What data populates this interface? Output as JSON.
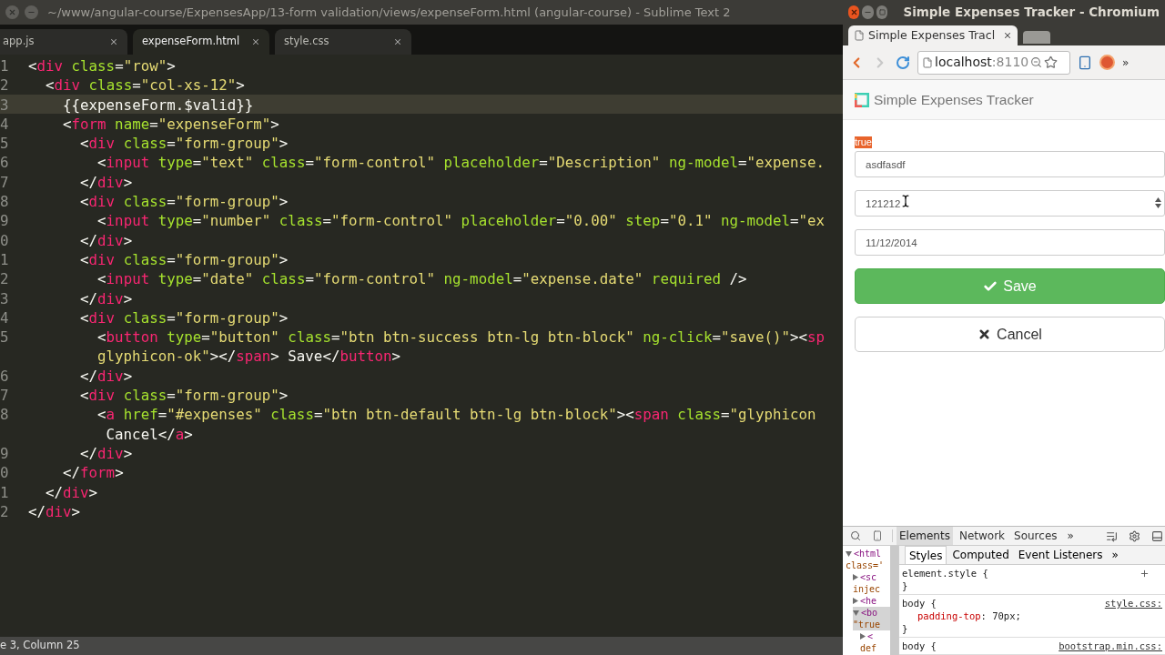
{
  "editor": {
    "title": "~/www/angular-course/ExpensesApp/13-form validation/views/expenseForm.html (angular-course) - Sublime Text 2",
    "tabs": [
      {
        "label": "app.js",
        "selected": false
      },
      {
        "label": "expenseForm.html",
        "selected": true
      },
      {
        "label": "style.css",
        "selected": false
      }
    ],
    "lines": [
      {
        "number": "1",
        "current": false,
        "tokens": [
          {
            "kind": "punct",
            "text": "<"
          },
          {
            "kind": "tag",
            "text": "div"
          },
          {
            "kind": "attr",
            "text": " class"
          },
          {
            "kind": "punct",
            "text": "="
          },
          {
            "kind": "string",
            "text": "\"row\""
          },
          {
            "kind": "punct",
            "text": ">"
          }
        ]
      },
      {
        "number": "2",
        "current": false,
        "tokens": [
          {
            "kind": "punct",
            "text": "  <"
          },
          {
            "kind": "tag",
            "text": "div"
          },
          {
            "kind": "attr",
            "text": " class"
          },
          {
            "kind": "punct",
            "text": "="
          },
          {
            "kind": "string",
            "text": "\"col-xs-12\""
          },
          {
            "kind": "punct",
            "text": ">"
          }
        ]
      },
      {
        "number": "3",
        "current": true,
        "tokens": [
          {
            "kind": "punct",
            "text": "    {{expenseForm.$valid}}"
          }
        ]
      },
      {
        "number": "4",
        "current": false,
        "tokens": [
          {
            "kind": "punct",
            "text": "    <"
          },
          {
            "kind": "tag",
            "text": "form"
          },
          {
            "kind": "attr",
            "text": " name"
          },
          {
            "kind": "punct",
            "text": "="
          },
          {
            "kind": "string",
            "text": "\"expenseForm\""
          },
          {
            "kind": "punct",
            "text": ">"
          }
        ]
      },
      {
        "number": "5",
        "current": false,
        "tokens": [
          {
            "kind": "punct",
            "text": "      <"
          },
          {
            "kind": "tag",
            "text": "div"
          },
          {
            "kind": "attr",
            "text": " class"
          },
          {
            "kind": "punct",
            "text": "="
          },
          {
            "kind": "string",
            "text": "\"form-group\""
          },
          {
            "kind": "punct",
            "text": ">"
          }
        ]
      },
      {
        "number": "6",
        "current": false,
        "tokens": [
          {
            "kind": "punct",
            "text": "        <"
          },
          {
            "kind": "tag",
            "text": "input"
          },
          {
            "kind": "attr",
            "text": " type"
          },
          {
            "kind": "punct",
            "text": "="
          },
          {
            "kind": "string",
            "text": "\"text\""
          },
          {
            "kind": "attr",
            "text": " class"
          },
          {
            "kind": "punct",
            "text": "="
          },
          {
            "kind": "string",
            "text": "\"form-control\""
          },
          {
            "kind": "attr",
            "text": " placeholder"
          },
          {
            "kind": "punct",
            "text": "="
          },
          {
            "kind": "string",
            "text": "\"Description\""
          },
          {
            "kind": "attr",
            "text": " ng-model"
          },
          {
            "kind": "punct",
            "text": "="
          },
          {
            "kind": "string",
            "text": "\"expense."
          }
        ]
      },
      {
        "number": "7",
        "current": false,
        "tokens": [
          {
            "kind": "punct",
            "text": "      </"
          },
          {
            "kind": "tag",
            "text": "div"
          },
          {
            "kind": "punct",
            "text": ">"
          }
        ]
      },
      {
        "number": "8",
        "current": false,
        "tokens": [
          {
            "kind": "punct",
            "text": "      <"
          },
          {
            "kind": "tag",
            "text": "div"
          },
          {
            "kind": "attr",
            "text": " class"
          },
          {
            "kind": "punct",
            "text": "="
          },
          {
            "kind": "string",
            "text": "\"form-group\""
          },
          {
            "kind": "punct",
            "text": ">"
          }
        ]
      },
      {
        "number": "9",
        "current": false,
        "tokens": [
          {
            "kind": "punct",
            "text": "        <"
          },
          {
            "kind": "tag",
            "text": "input"
          },
          {
            "kind": "attr",
            "text": " type"
          },
          {
            "kind": "punct",
            "text": "="
          },
          {
            "kind": "string",
            "text": "\"number\""
          },
          {
            "kind": "attr",
            "text": " class"
          },
          {
            "kind": "punct",
            "text": "="
          },
          {
            "kind": "string",
            "text": "\"form-control\""
          },
          {
            "kind": "attr",
            "text": " placeholder"
          },
          {
            "kind": "punct",
            "text": "="
          },
          {
            "kind": "string",
            "text": "\"0.00\""
          },
          {
            "kind": "attr",
            "text": " step"
          },
          {
            "kind": "punct",
            "text": "="
          },
          {
            "kind": "string",
            "text": "\"0.1\""
          },
          {
            "kind": "attr",
            "text": " ng-model"
          },
          {
            "kind": "punct",
            "text": "="
          },
          {
            "kind": "string",
            "text": "\"ex"
          }
        ]
      },
      {
        "number": "0",
        "current": false,
        "tokens": [
          {
            "kind": "punct",
            "text": "      </"
          },
          {
            "kind": "tag",
            "text": "div"
          },
          {
            "kind": "punct",
            "text": ">"
          }
        ]
      },
      {
        "number": "1",
        "current": false,
        "tokens": [
          {
            "kind": "punct",
            "text": "      <"
          },
          {
            "kind": "tag",
            "text": "div"
          },
          {
            "kind": "attr",
            "text": " class"
          },
          {
            "kind": "punct",
            "text": "="
          },
          {
            "kind": "string",
            "text": "\"form-group\""
          },
          {
            "kind": "punct",
            "text": ">"
          }
        ]
      },
      {
        "number": "2",
        "current": false,
        "tokens": [
          {
            "kind": "punct",
            "text": "        <"
          },
          {
            "kind": "tag",
            "text": "input"
          },
          {
            "kind": "attr",
            "text": " type"
          },
          {
            "kind": "punct",
            "text": "="
          },
          {
            "kind": "string",
            "text": "\"date\""
          },
          {
            "kind": "attr",
            "text": " class"
          },
          {
            "kind": "punct",
            "text": "="
          },
          {
            "kind": "string",
            "text": "\"form-control\""
          },
          {
            "kind": "attr",
            "text": " ng-model"
          },
          {
            "kind": "punct",
            "text": "="
          },
          {
            "kind": "string",
            "text": "\"expense.date\""
          },
          {
            "kind": "attr",
            "text": " required"
          },
          {
            "kind": "punct",
            "text": " />"
          }
        ]
      },
      {
        "number": "3",
        "current": false,
        "tokens": [
          {
            "kind": "punct",
            "text": "      </"
          },
          {
            "kind": "tag",
            "text": "div"
          },
          {
            "kind": "punct",
            "text": ">"
          }
        ]
      },
      {
        "number": "4",
        "current": false,
        "tokens": [
          {
            "kind": "punct",
            "text": "      <"
          },
          {
            "kind": "tag",
            "text": "div"
          },
          {
            "kind": "attr",
            "text": " class"
          },
          {
            "kind": "punct",
            "text": "="
          },
          {
            "kind": "string",
            "text": "\"form-group\""
          },
          {
            "kind": "punct",
            "text": ">"
          }
        ]
      },
      {
        "number": "5",
        "current": false,
        "tokens": [
          {
            "kind": "punct",
            "text": "        <"
          },
          {
            "kind": "tag",
            "text": "button"
          },
          {
            "kind": "attr",
            "text": " type"
          },
          {
            "kind": "punct",
            "text": "="
          },
          {
            "kind": "string",
            "text": "\"button\""
          },
          {
            "kind": "attr",
            "text": " class"
          },
          {
            "kind": "punct",
            "text": "="
          },
          {
            "kind": "string",
            "text": "\"btn btn-success btn-lg btn-block\""
          },
          {
            "kind": "attr",
            "text": " ng-click"
          },
          {
            "kind": "punct",
            "text": "="
          },
          {
            "kind": "string",
            "text": "\"save()\""
          },
          {
            "kind": "punct",
            "text": "><"
          },
          {
            "kind": "tag",
            "text": "sp"
          }
        ],
        "wrap": [
          {
            "kind": "string",
            "text": "glyphicon-ok\""
          },
          {
            "kind": "punct",
            "text": "></"
          },
          {
            "kind": "tag",
            "text": "span"
          },
          {
            "kind": "punct",
            "text": "> Save</"
          },
          {
            "kind": "tag",
            "text": "button"
          },
          {
            "kind": "punct",
            "text": ">"
          }
        ]
      },
      {
        "number": "6",
        "current": false,
        "tokens": [
          {
            "kind": "punct",
            "text": "      </"
          },
          {
            "kind": "tag",
            "text": "div"
          },
          {
            "kind": "punct",
            "text": ">"
          }
        ]
      },
      {
        "number": "7",
        "current": false,
        "tokens": [
          {
            "kind": "punct",
            "text": "      <"
          },
          {
            "kind": "tag",
            "text": "div"
          },
          {
            "kind": "attr",
            "text": " class"
          },
          {
            "kind": "punct",
            "text": "="
          },
          {
            "kind": "string",
            "text": "\"form-group\""
          },
          {
            "kind": "punct",
            "text": ">"
          }
        ]
      },
      {
        "number": "8",
        "current": false,
        "tokens": [
          {
            "kind": "punct",
            "text": "        <"
          },
          {
            "kind": "tag",
            "text": "a"
          },
          {
            "kind": "attr",
            "text": " href"
          },
          {
            "kind": "punct",
            "text": "="
          },
          {
            "kind": "string",
            "text": "\"#expenses\""
          },
          {
            "kind": "attr",
            "text": " class"
          },
          {
            "kind": "punct",
            "text": "="
          },
          {
            "kind": "string",
            "text": "\"btn btn-default btn-lg btn-block\""
          },
          {
            "kind": "punct",
            "text": "><"
          },
          {
            "kind": "tag",
            "text": "span"
          },
          {
            "kind": "attr",
            "text": " class"
          },
          {
            "kind": "punct",
            "text": "="
          },
          {
            "kind": "string",
            "text": "\"glyphicon"
          }
        ],
        "wrap": [
          {
            "kind": "punct",
            "text": " Cancel</"
          },
          {
            "kind": "tag",
            "text": "a"
          },
          {
            "kind": "punct",
            "text": ">"
          }
        ]
      },
      {
        "number": "9",
        "current": false,
        "tokens": [
          {
            "kind": "punct",
            "text": "      </"
          },
          {
            "kind": "tag",
            "text": "div"
          },
          {
            "kind": "punct",
            "text": ">"
          }
        ]
      },
      {
        "number": "0",
        "current": false,
        "tokens": [
          {
            "kind": "punct",
            "text": "    </"
          },
          {
            "kind": "tag",
            "text": "form"
          },
          {
            "kind": "punct",
            "text": ">"
          }
        ]
      },
      {
        "number": "1",
        "current": false,
        "tokens": [
          {
            "kind": "punct",
            "text": "  </"
          },
          {
            "kind": "tag",
            "text": "div"
          },
          {
            "kind": "punct",
            "text": ">"
          }
        ]
      },
      {
        "number": "2",
        "current": false,
        "tokens": [
          {
            "kind": "punct",
            "text": "</"
          },
          {
            "kind": "tag",
            "text": "div"
          },
          {
            "kind": "punct",
            "text": ">"
          }
        ]
      }
    ],
    "status_bar": "e 3, Column 25"
  },
  "browser": {
    "title": "Simple Expenses Tracker - Chromium",
    "tab": {
      "label": "Simple Expenses Tracl"
    },
    "address": {
      "host": "localhost",
      "port": ":8110"
    },
    "more_label": "»",
    "page": {
      "brand": "Simple Expenses Tracker",
      "valid_output": {
        "text": "true",
        "selected": true
      },
      "fields": [
        {
          "kind": "text",
          "value": "asdfasdf"
        },
        {
          "kind": "number",
          "value": "121212"
        },
        {
          "kind": "date",
          "value": "11/12/2014"
        }
      ],
      "buttons": [
        {
          "kind": "success",
          "label": "Save"
        },
        {
          "kind": "default",
          "label": "Cancel"
        }
      ]
    },
    "devtools": {
      "tabs": [
        {
          "label": "Elements",
          "selected": true
        },
        {
          "label": "Network",
          "selected": false
        },
        {
          "label": "Sources",
          "selected": false
        }
      ],
      "more_label": "»",
      "dom": [
        {
          "text": "<html",
          "cont": "class='",
          "expanded": true,
          "selected": false,
          "children": [
            {
              "text": "<sc",
              "cont": "injec",
              "expanded": false,
              "selected": false
            },
            {
              "text": "<he",
              "expanded": false,
              "selected": false
            },
            {
              "text": "<bo",
              "cont": "\"true",
              "expanded": true,
              "selected": true,
              "children": [
                {
                  "text": "<",
                  "cont": "def",
                  "expanded": false,
                  "selected": false
                }
              ]
            }
          ]
        }
      ],
      "subtabs": [
        {
          "label": "Styles",
          "selected": true
        },
        {
          "label": "Computed",
          "selected": false
        },
        {
          "label": "Event Listeners",
          "selected": false
        }
      ],
      "subtabs_more": "»",
      "rules": [
        {
          "selector": "element.style {",
          "close": "}"
        },
        {
          "selector": "body {",
          "source": "style.css:",
          "declarations": [
            {
              "property": "padding-top",
              "value": ": 70px;"
            }
          ],
          "close": "}"
        },
        {
          "selector": "body {",
          "source": "bootstrap.min.css:"
        }
      ]
    }
  }
}
